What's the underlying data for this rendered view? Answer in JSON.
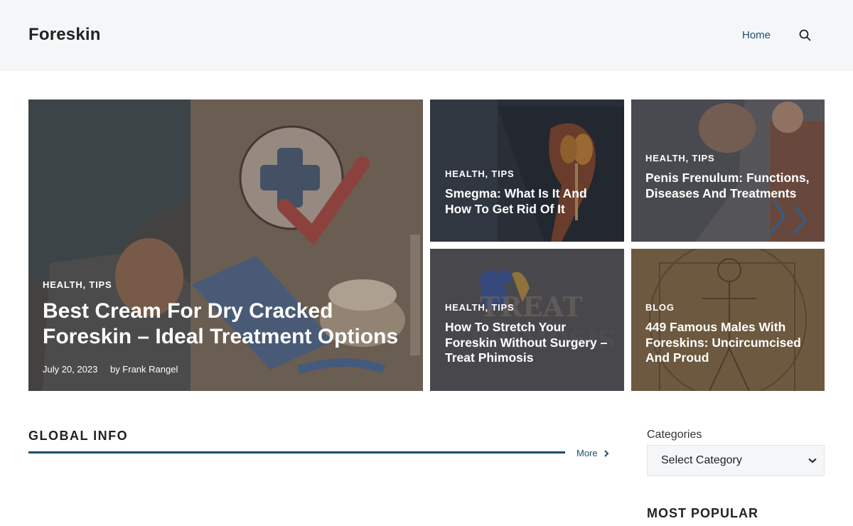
{
  "header": {
    "site_title": "Foreskin",
    "nav": {
      "home_label": "Home"
    },
    "search_icon": "search-icon"
  },
  "featured": [
    {
      "category": "HEALTH, TIPS",
      "title": "Best Cream For Dry Cracked Foreskin – Ideal Treatment Options",
      "date": "July 20, 2023",
      "author": "by Frank Rangel"
    },
    {
      "category": "HEALTH, TIPS",
      "title": "Smegma: What Is It And How To Get Rid Of It"
    },
    {
      "category": "HEALTH, TIPS",
      "title": "Penis Frenulum: Functions, Diseases And Treatments"
    },
    {
      "category": "HEALTH, TIPS",
      "title": "How To Stretch Your Foreskin Without Surgery – Treat Phimosis",
      "image_text": "TREAT"
    },
    {
      "category": "BLOG",
      "title": "449 Famous Males With Foreskins: Uncircumcised And Proud"
    }
  ],
  "global_info": {
    "title": "GLOBAL INFO",
    "more_label": "More",
    "more_icon": "chevron-right-icon"
  },
  "sidebar": {
    "categories_label": "Categories",
    "categories_select": "Select Category",
    "select_icon": "chevron-down-icon",
    "most_popular_title": "MOST POPULAR"
  },
  "colors": {
    "header_bg": "#f4f6f8",
    "accent": "#1e4d6b"
  }
}
